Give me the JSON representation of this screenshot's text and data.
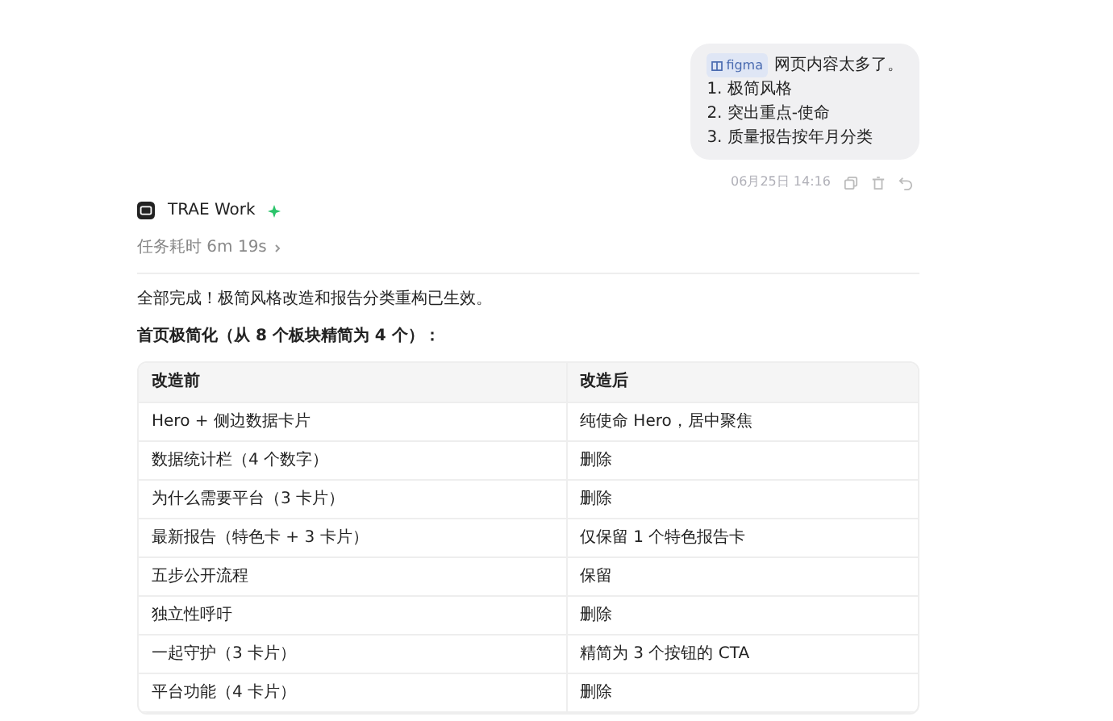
{
  "user_message": {
    "tag": "figma",
    "lines": [
      "网页内容太多了。",
      "1. 极简风格",
      "2. 突出重点-使命",
      "3. 质量报告按年月分类"
    ],
    "time": "06月25日 14:16"
  },
  "assistant": {
    "name": "TRAE Work",
    "duration": "任务耗时 6m 19s",
    "expanded": false,
    "intro": "全部完成！极简风格改造和报告分类重构已生效。",
    "heading": "首页极简化（从 8 个板块精简为 4 个）："
  },
  "table": {
    "columns": [
      "改造前",
      "改造后"
    ],
    "rows": [
      [
        "Hero + 侧边数据卡片",
        "纯使命 Hero，居中聚焦"
      ],
      [
        "数据统计栏（4 个数字）",
        "删除"
      ],
      [
        "为什么需要平台（3 卡片）",
        "删除"
      ],
      [
        "最新报告（特色卡 + 3 卡片）",
        "仅保留 1 个特色报告卡"
      ],
      [
        "五步公开流程",
        "保留"
      ],
      [
        "独立性呼吁",
        "删除"
      ],
      [
        "一起守护（3 卡片）",
        "精简为 3 个按钮的 CTA"
      ],
      [
        "平台功能（4 卡片）",
        "删除"
      ]
    ]
  }
}
